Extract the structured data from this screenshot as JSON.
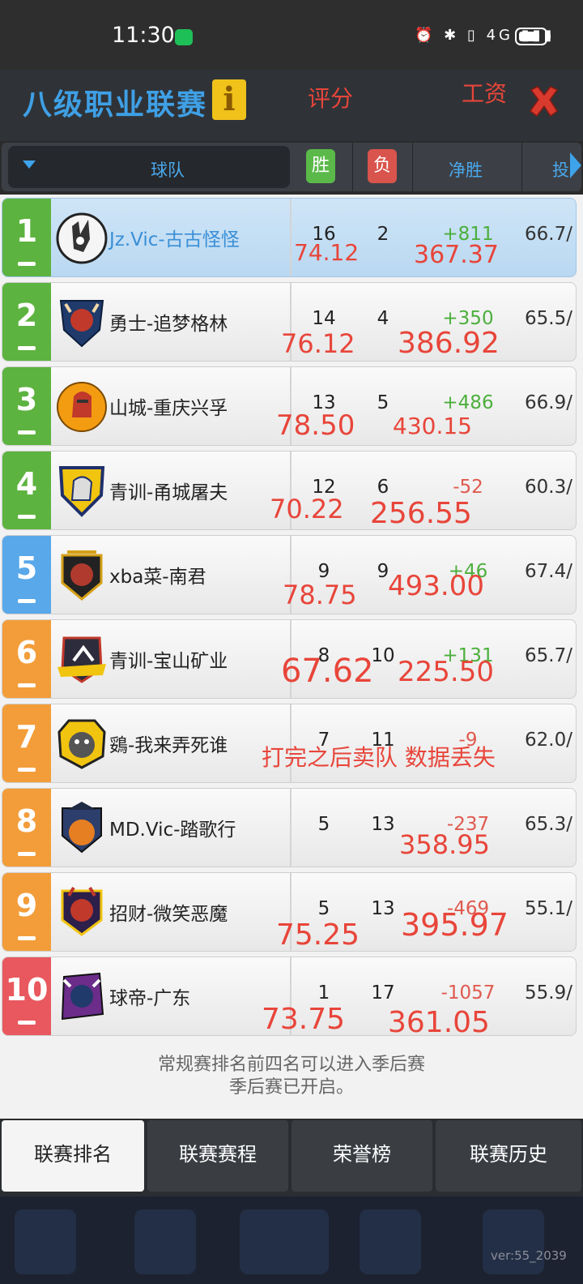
{
  "status_bar": {
    "time": "11:30",
    "icons": "⏰ ✱ ▯ 4G ▮▮▮"
  },
  "header": {
    "title": "八级职业联赛",
    "info_icon": "i",
    "annotation_score": "评分",
    "annotation_salary": "工资",
    "close_icon": "close-icon"
  },
  "table_header": {
    "team": "球队",
    "win": "胜",
    "lose": "负",
    "net": "净胜",
    "more": "投"
  },
  "rows": [
    {
      "rank": "1",
      "team": "Jz.Vic-古古怪怪",
      "w": "16",
      "l": "2",
      "net": "+811",
      "pct": "66.7/",
      "hw1": "74.12",
      "hw2": "367.37",
      "rank_color": "#5db33f"
    },
    {
      "rank": "2",
      "team": "勇士-追梦格林",
      "w": "14",
      "l": "4",
      "net": "+350",
      "pct": "65.5/",
      "hw1": "76.12",
      "hw2": "386.92",
      "rank_color": "#5db33f"
    },
    {
      "rank": "3",
      "team": "山城-重庆兴孚",
      "w": "13",
      "l": "5",
      "net": "+486",
      "pct": "66.9/",
      "hw1": "78.50",
      "hw2": "430.15",
      "rank_color": "#5db33f"
    },
    {
      "rank": "4",
      "team": "青训-甬城屠夫",
      "w": "12",
      "l": "6",
      "net": "-52",
      "pct": "60.3/",
      "hw1": "70.22",
      "hw2": "256.55",
      "rank_color": "#5db33f"
    },
    {
      "rank": "5",
      "team": "xba菜-南君",
      "w": "9",
      "l": "9",
      "net": "+46",
      "pct": "67.4/",
      "hw1": "78.75",
      "hw2": "493.00",
      "rank_color": "#58a8ea"
    },
    {
      "rank": "6",
      "team": "青训-宝山矿业",
      "w": "8",
      "l": "10",
      "net": "+131",
      "pct": "65.7/",
      "hw1": "67.62",
      "hw2": "225.50",
      "rank_color": "#f39d3a"
    },
    {
      "rank": "7",
      "team": "鵎-我来弄死谁",
      "w": "7",
      "l": "11",
      "net": "-9",
      "pct": "62.0/",
      "hw1": "打完之后卖队 数据丢失",
      "hw2": "",
      "rank_color": "#f39d3a"
    },
    {
      "rank": "8",
      "team": "MD.Vic-踏歌行",
      "w": "5",
      "l": "13",
      "net": "-237",
      "pct": "65.3/",
      "hw1": "",
      "hw2": "358.95",
      "rank_color": "#f39d3a"
    },
    {
      "rank": "9",
      "team": "招财-微笑恶魔",
      "w": "5",
      "l": "13",
      "net": "-469",
      "pct": "55.1/",
      "hw1": "75.25",
      "hw2": "395.97",
      "rank_color": "#f39d3a"
    },
    {
      "rank": "10",
      "team": "球帝-广东",
      "w": "1",
      "l": "17",
      "net": "-1057",
      "pct": "55.9/",
      "hw1": "73.75",
      "hw2": "361.05",
      "rank_color": "#e8585e"
    }
  ],
  "notes": {
    "line1": "常规赛排名前四名可以进入季后赛",
    "line2": "季后赛已开启。"
  },
  "tabs": [
    "联赛排名",
    "联赛赛程",
    "荣誉榜",
    "联赛历史"
  ],
  "version": "ver:55_2039",
  "colors": {
    "accent": "#3fa0e6",
    "win": "#5bb94a",
    "lose": "#d9544c",
    "handwriting": "#e8453a"
  }
}
